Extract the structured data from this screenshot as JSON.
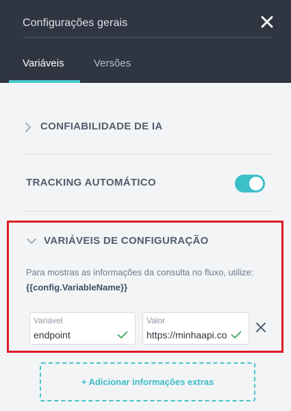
{
  "header": {
    "title": "Configurações gerais",
    "tabs": [
      {
        "label": "Variáveis",
        "active": true
      },
      {
        "label": "Versões",
        "active": false
      }
    ]
  },
  "sections": {
    "ai_confidence": {
      "label": "CONFIABILIDADE DE IA",
      "expanded": false
    },
    "auto_tracking": {
      "label": "TRACKING AUTOMÁTICO",
      "enabled": true
    },
    "config_variables": {
      "label": "VARIÁVEIS DE CONFIGURAÇÃO",
      "expanded": true,
      "help_text": "Para mostras as informações da consulta no fluxo, utilize:",
      "help_code": "{{config.VariableName}}",
      "variable_field": {
        "label": "Variável",
        "value": "endpoint"
      },
      "value_field": {
        "label": "Valor",
        "value": "https://minhaapi.co"
      }
    }
  },
  "add_button": {
    "label": "+ Adicionar informações extras"
  },
  "colors": {
    "header_bg": "#2f3541",
    "accent": "#48c7cf",
    "highlight_border": "#e01b24",
    "check": "#3aa35a"
  }
}
